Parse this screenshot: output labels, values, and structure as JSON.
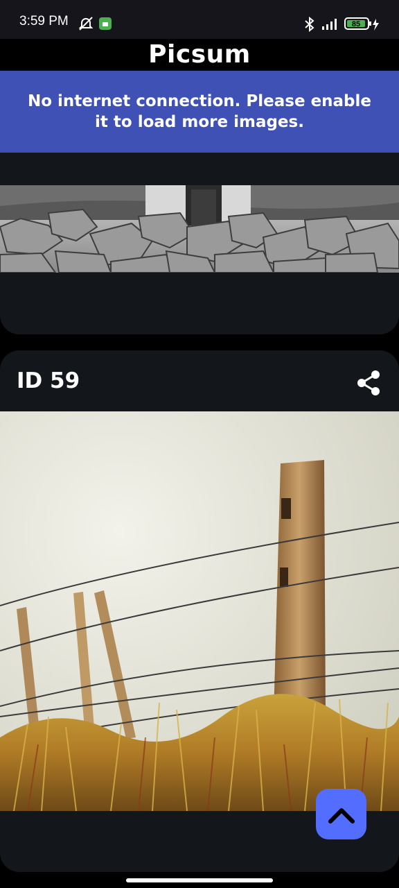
{
  "status_bar": {
    "time": "3:59 PM",
    "battery": "85"
  },
  "app": {
    "title": "Picsum"
  },
  "banner": {
    "message": "No internet connection. Please enable it to load more images."
  },
  "cards": [
    {
      "image_kind": "rocks-and-lighthouse-bw"
    },
    {
      "label": "ID 59",
      "image_kind": "fence-post-grass"
    }
  ],
  "colors": {
    "banner": "#3f51b5",
    "card": "#13161a",
    "fab": "#536dfe",
    "background": "#000000"
  },
  "icons": [
    "share-icon",
    "arrow-up-icon",
    "bluetooth-icon",
    "signal-icon",
    "battery-icon",
    "mute-icon",
    "android-icon"
  ]
}
